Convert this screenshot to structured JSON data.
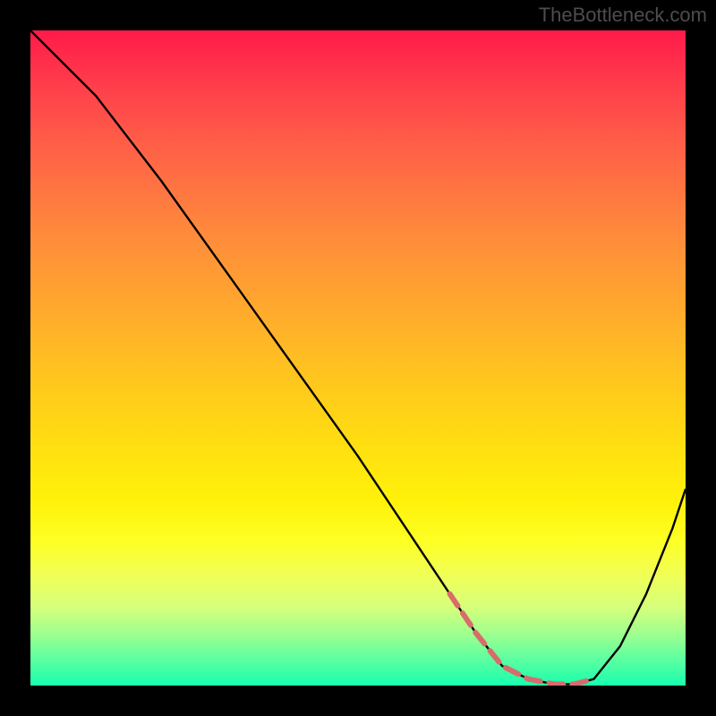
{
  "watermark": "TheBottleneck.com",
  "chart_data": {
    "type": "line",
    "title": "",
    "xlabel": "",
    "ylabel": "",
    "xlim": [
      0,
      100
    ],
    "ylim": [
      0,
      100
    ],
    "series": [
      {
        "name": "curve",
        "x": [
          0,
          2,
          6,
          10,
          20,
          30,
          40,
          50,
          60,
          64,
          68,
          72,
          76,
          80,
          83,
          86,
          90,
          94,
          98,
          100
        ],
        "y": [
          100,
          98,
          94,
          90,
          77,
          63,
          49,
          35,
          20,
          14,
          8,
          3,
          1,
          0.2,
          0.2,
          1,
          6,
          14,
          24,
          30
        ]
      }
    ],
    "highlight": {
      "name": "dashed-optimal-region",
      "color": "#d96b6b",
      "x": [
        64,
        68,
        72,
        76,
        80,
        83,
        86
      ],
      "y": [
        14,
        8,
        3,
        1,
        0.2,
        0.2,
        1
      ]
    },
    "background_gradient": {
      "top": "#ff1a4a",
      "middle": "#ffe010",
      "bottom": "#17ffad"
    }
  }
}
